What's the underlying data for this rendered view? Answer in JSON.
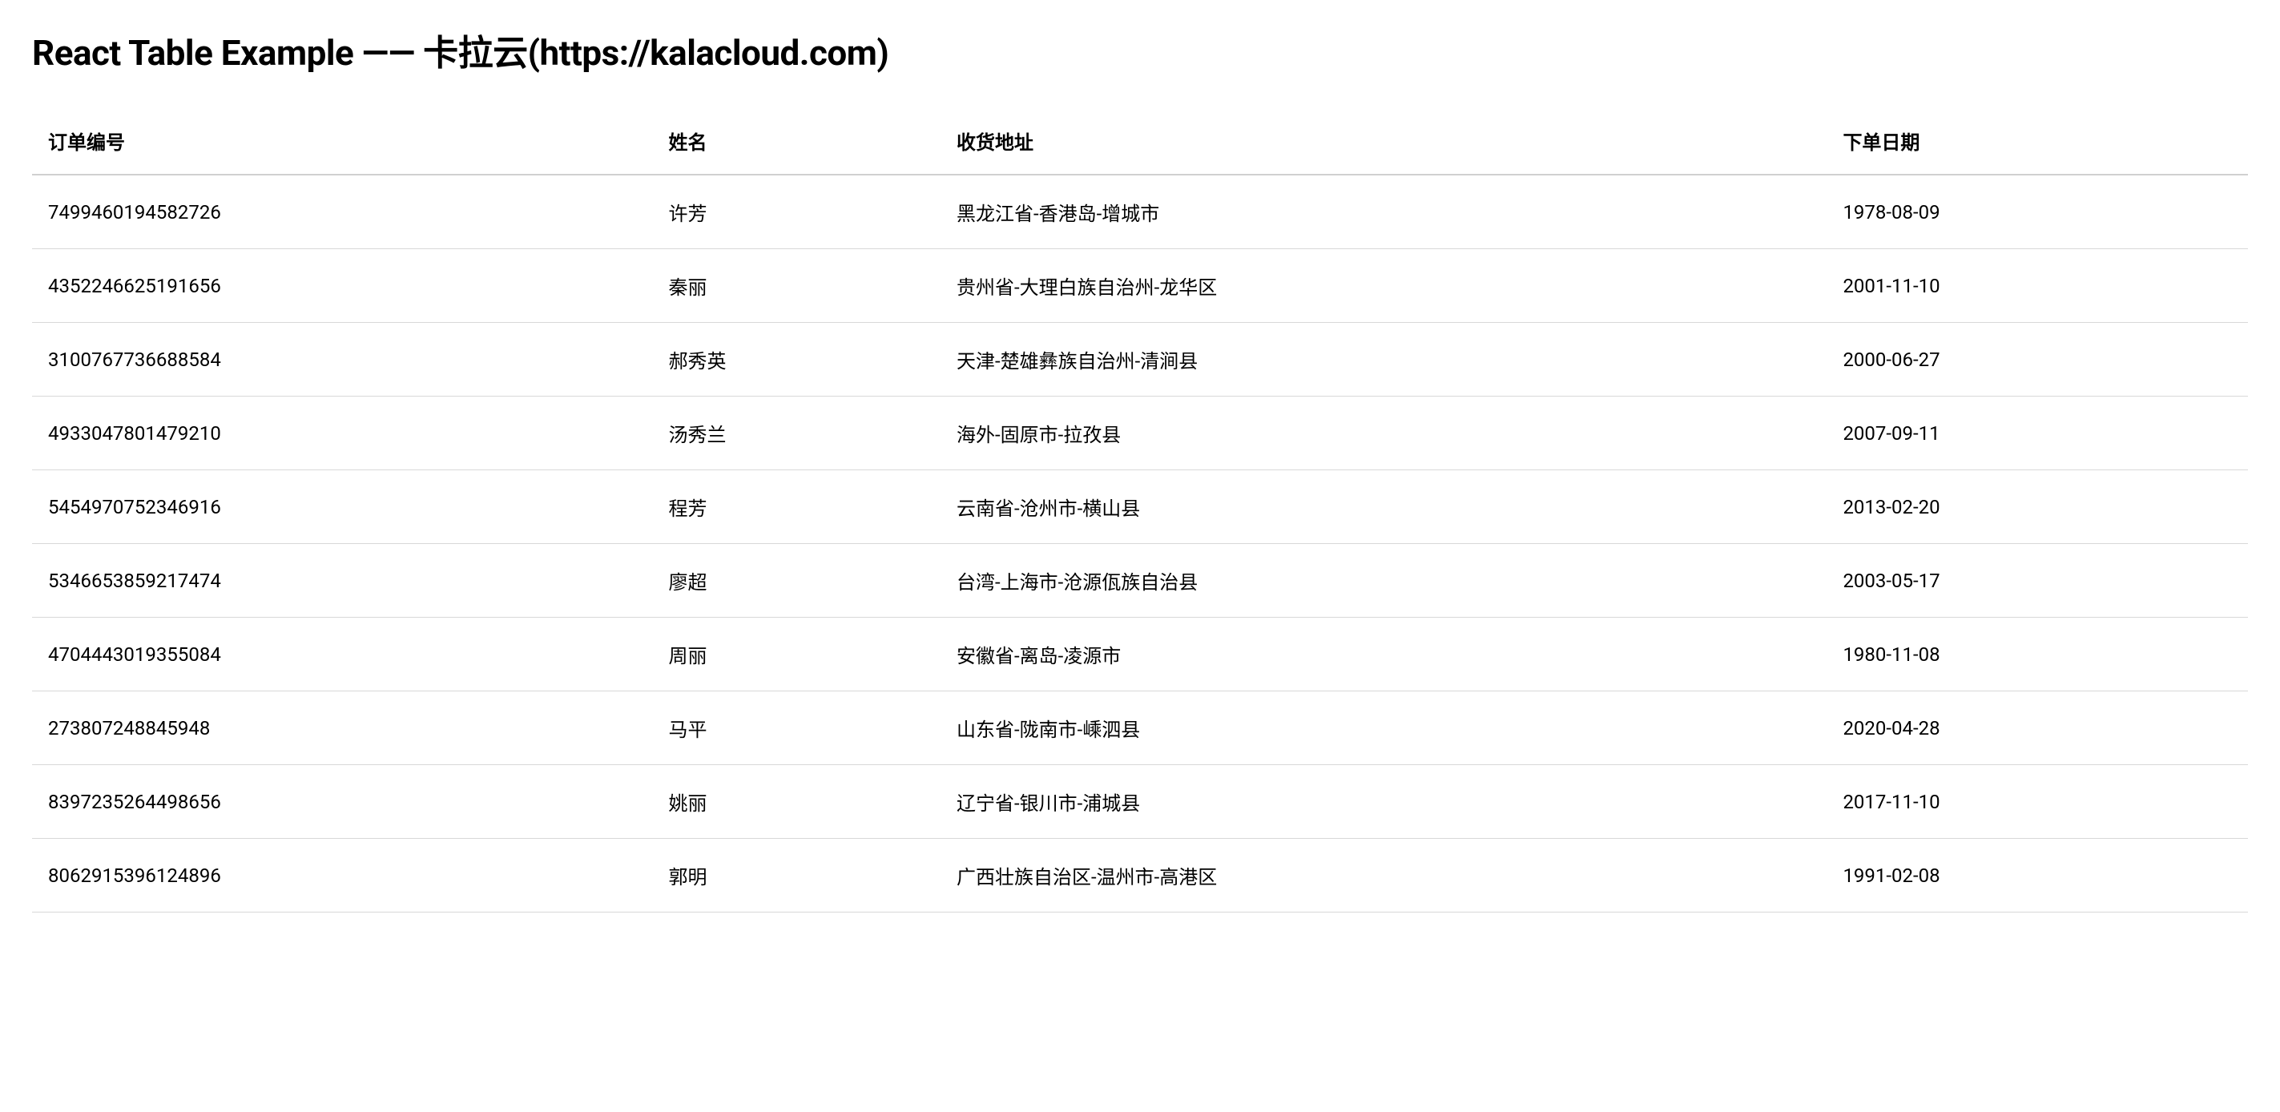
{
  "title": "React Table Example —— 卡拉云(https://kalacloud.com)",
  "table": {
    "headers": {
      "order_id": "订单编号",
      "name": "姓名",
      "address": "收货地址",
      "date": "下单日期"
    },
    "rows": [
      {
        "order_id": "7499460194582726",
        "name": "许芳",
        "address": "黑龙江省-香港岛-增城市",
        "date": "1978-08-09"
      },
      {
        "order_id": "4352246625191656",
        "name": "秦丽",
        "address": "贵州省-大理白族自治州-龙华区",
        "date": "2001-11-10"
      },
      {
        "order_id": "3100767736688584",
        "name": "郝秀英",
        "address": "天津-楚雄彝族自治州-清涧县",
        "date": "2000-06-27"
      },
      {
        "order_id": "4933047801479210",
        "name": "汤秀兰",
        "address": "海外-固原市-拉孜县",
        "date": "2007-09-11"
      },
      {
        "order_id": "5454970752346916",
        "name": "程芳",
        "address": "云南省-沧州市-横山县",
        "date": "2013-02-20"
      },
      {
        "order_id": "5346653859217474",
        "name": "廖超",
        "address": "台湾-上海市-沧源佤族自治县",
        "date": "2003-05-17"
      },
      {
        "order_id": "4704443019355084",
        "name": "周丽",
        "address": "安徽省-离岛-凌源市",
        "date": "1980-11-08"
      },
      {
        "order_id": "273807248845948",
        "name": "马平",
        "address": "山东省-陇南市-嵊泗县",
        "date": "2020-04-28"
      },
      {
        "order_id": "8397235264498656",
        "name": "姚丽",
        "address": "辽宁省-银川市-浦城县",
        "date": "2017-11-10"
      },
      {
        "order_id": "8062915396124896",
        "name": "郭明",
        "address": "广西壮族自治区-温州市-高港区",
        "date": "1991-02-08"
      }
    ]
  }
}
